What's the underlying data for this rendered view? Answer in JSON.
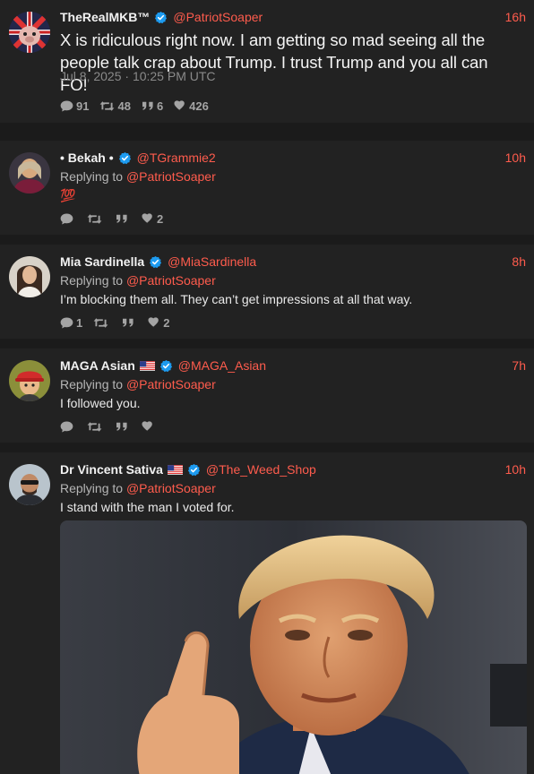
{
  "posts": [
    {
      "name": "TheRealMKB™",
      "handle": "@PatriotSoaper",
      "time": "16h",
      "text": "X is ridiculous right now. I am getting so mad seeing all the people talk crap about Trump. I trust Trump and you all can FO!",
      "date": "Jul 8, 2025 · 10:25 PM UTC",
      "replies": "91",
      "retweets": "48",
      "quotes": "6",
      "likes": "426"
    },
    {
      "name": "• Bekah •",
      "handle": "@TGrammie2",
      "time": "10h",
      "replying_label": "Replying to",
      "replying_to": "@PatriotSoaper",
      "text": "💯",
      "replies": "",
      "retweets": "",
      "quotes": "",
      "likes": "2"
    },
    {
      "name": "Mia Sardinella",
      "handle": "@MiaSardinella",
      "time": "8h",
      "replying_label": "Replying to",
      "replying_to": "@PatriotSoaper",
      "text": "I’m blocking them all. They can’t get impressions at all that way.",
      "replies": "1",
      "retweets": "",
      "quotes": "",
      "likes": "2"
    },
    {
      "name": "MAGA Asian",
      "handle": "@MAGA_Asian",
      "time": "7h",
      "replying_label": "Replying to",
      "replying_to": "@PatriotSoaper",
      "text": "I followed you.",
      "replies": "",
      "retweets": "",
      "quotes": "",
      "likes": ""
    },
    {
      "name": "Dr Vincent Sativa",
      "handle": "@The_Weed_Shop",
      "time": "10h",
      "replying_label": "Replying to",
      "replying_to": "@PatriotSoaper",
      "text": "I stand with the man I voted for."
    }
  ],
  "icons": {
    "reply": "comment-bubble-icon",
    "retweet": "retweet-icon",
    "quote": "quote-icon",
    "like": "heart-icon",
    "verified": "verified-badge-icon",
    "flag": "us-flag-icon"
  },
  "colors": {
    "background": "#1b1b1b",
    "card": "#222222",
    "accent": "#ff5c4d",
    "verified": "#1d9bf0"
  }
}
